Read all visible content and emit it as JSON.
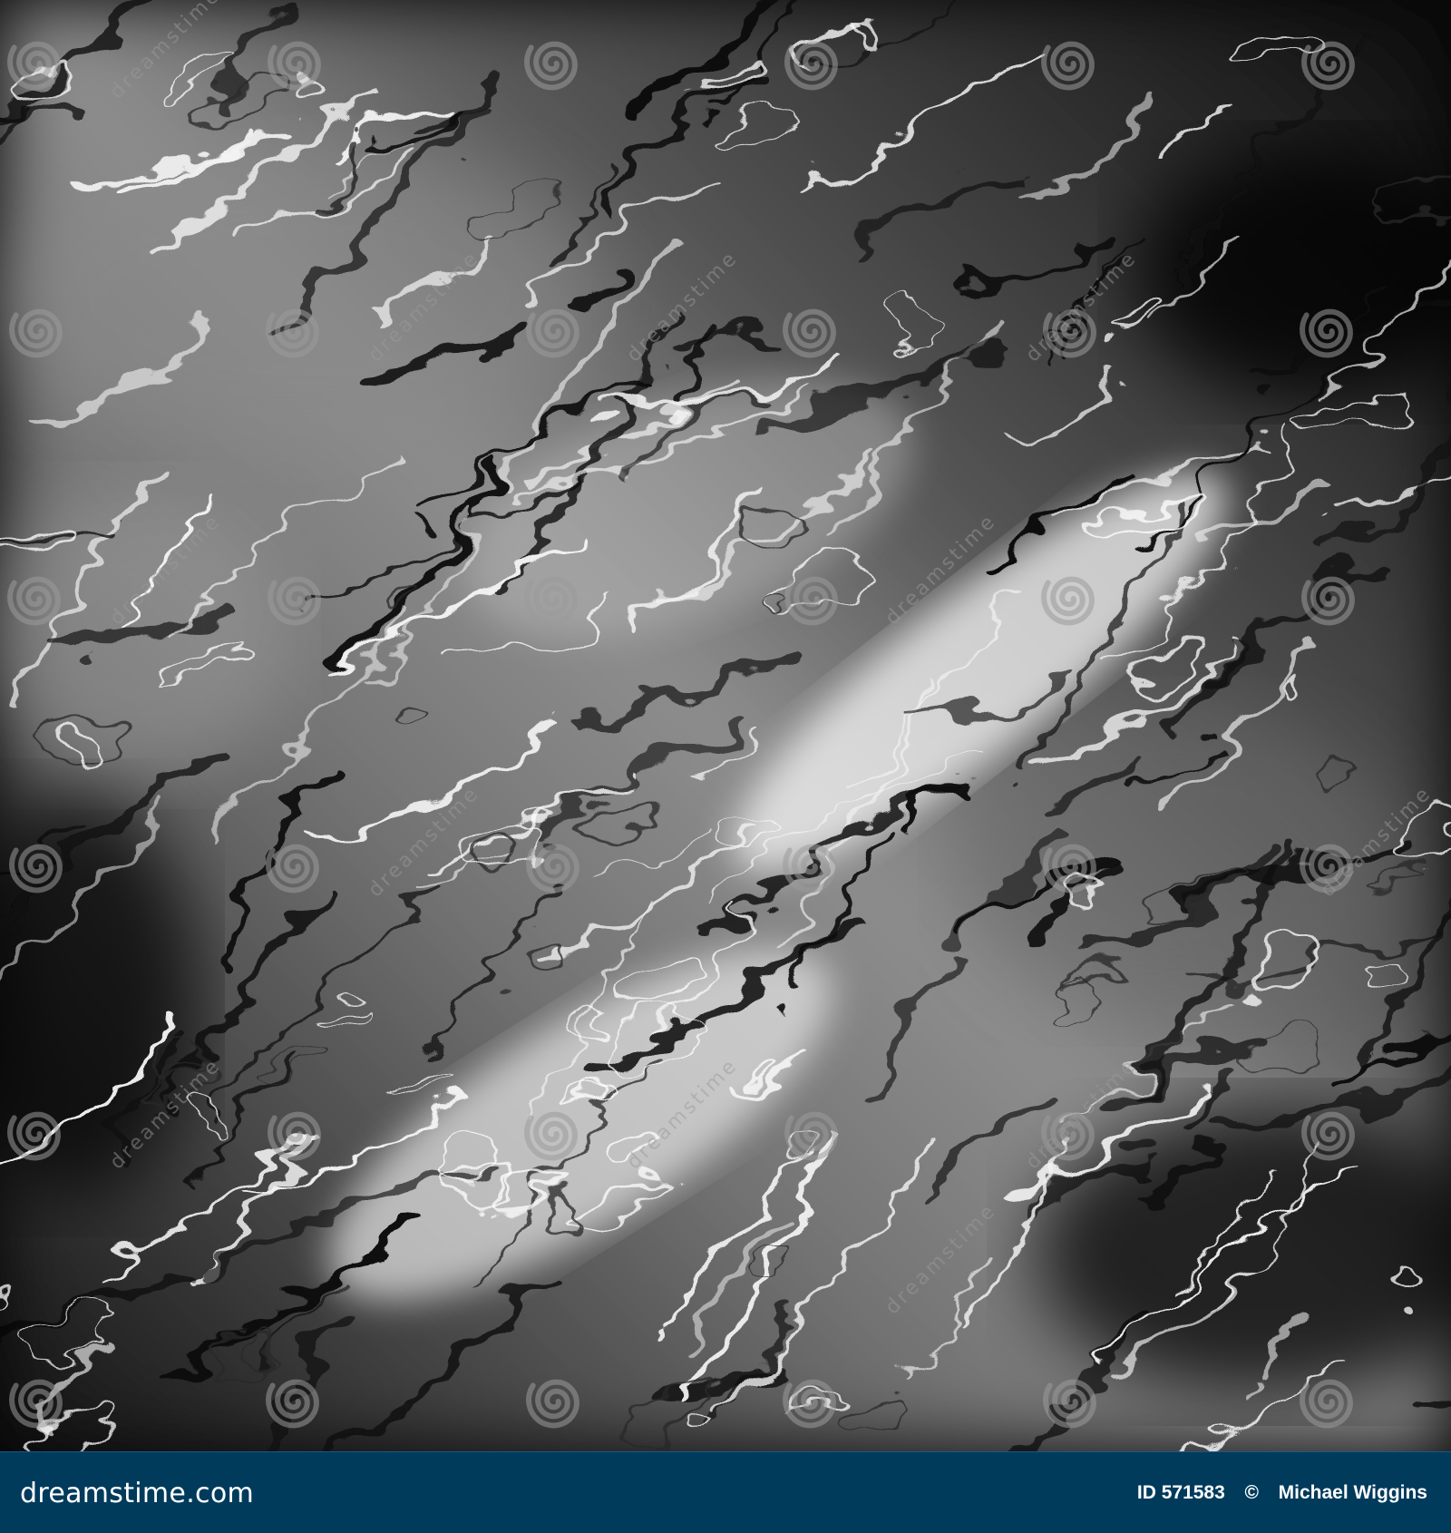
{
  "image": {
    "subject": "abstract",
    "colors": {
      "background": "#000000",
      "highlight": "#f5f5f5",
      "mid": "#8a8a8a",
      "watermark": "#9a9a9a"
    }
  },
  "watermark": {
    "icon": "swirl-icon",
    "text": "dreamstime"
  },
  "footer": {
    "color": "#003b5c",
    "logo_text": "dreamstime.com",
    "image_id": "ID 571583",
    "copyright_symbol": "©",
    "author": "Michael Wiggins"
  }
}
